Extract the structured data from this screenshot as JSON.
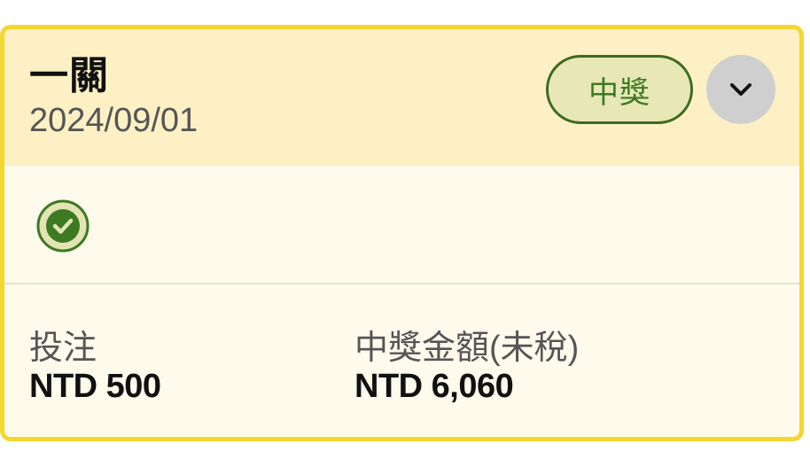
{
  "card": {
    "title": "一關",
    "date": "2024/09/01",
    "badge_label": "中獎",
    "toggle_icon": "chevron-down-icon",
    "status_icon": "check-circle-icon",
    "bet": {
      "label": "投注",
      "value": "NTD 500"
    },
    "prize": {
      "label": "中獎金額(未稅)",
      "value": "NTD 6,060"
    }
  },
  "colors": {
    "border": "#f4d631",
    "header_bg": "#fcf0c4",
    "body_bg": "#fffbec",
    "badge_bg": "#e8e8b7",
    "badge_text": "#3d7a22",
    "success": "#3d7a22",
    "toggle_bg": "#cfcfcf"
  }
}
